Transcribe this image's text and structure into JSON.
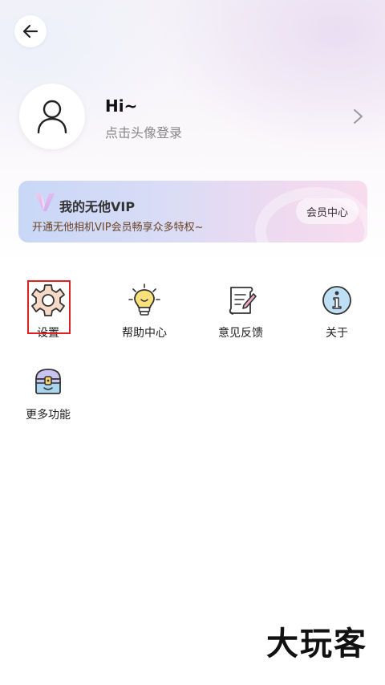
{
  "header": {
    "back_icon": "arrow-left-icon"
  },
  "profile": {
    "avatar_icon": "user-icon",
    "greeting": "Hi~",
    "login_hint": "点击头像登录",
    "chevron_icon": "chevron-right-icon"
  },
  "vip": {
    "logo_icon": "vip-logo-icon",
    "title": "我的无他VIP",
    "subtitle": "开通无他相机VIP会员畅享众多特权~",
    "button": "会员中心"
  },
  "menu": [
    {
      "label": "设置",
      "icon": "gear-icon"
    },
    {
      "label": "帮助中心",
      "icon": "lightbulb-icon"
    },
    {
      "label": "意见反馈",
      "icon": "scroll-pen-icon"
    },
    {
      "label": "关于",
      "icon": "info-icon"
    },
    {
      "label": "更多功能",
      "icon": "treasure-chest-icon"
    }
  ],
  "watermark": "大玩客",
  "colors": {
    "highlight": "#e02020",
    "vip_text": "#6b4426"
  }
}
